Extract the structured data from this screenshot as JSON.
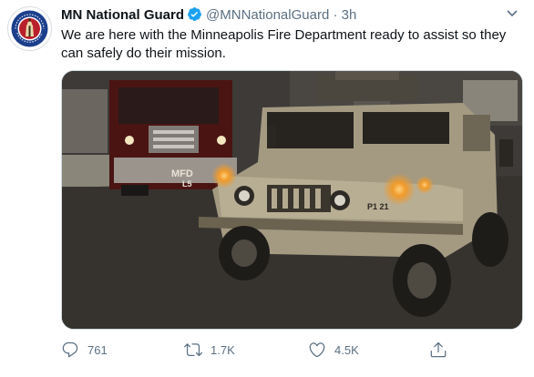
{
  "tweet": {
    "display_name": "MN National Guard",
    "handle": "@MNNationalGuard",
    "separator": "·",
    "time": "3h",
    "text": "We are here with the Minneapolis Fire Department ready to assist so they can safely do their mission.",
    "avatar_icon": "minnesota-national-guard-seal-icon",
    "avatar_text": "MINNESOTA NATIONAL GUARD · ALWAYS READY",
    "more_icon": "more-options-icon",
    "verified_color": "#1da1f2",
    "photo": {
      "truck_marking_1": "MFD",
      "truck_marking_2": "L5",
      "vehicle_marking": "P1 21"
    }
  },
  "actions": {
    "reply": {
      "icon": "reply-icon",
      "count": "761"
    },
    "retweet": {
      "icon": "retweet-icon",
      "count": "1.7K"
    },
    "like": {
      "icon": "like-icon",
      "count": "4.5K"
    },
    "share": {
      "icon": "share-icon",
      "count": ""
    }
  },
  "colors": {
    "text_primary": "#0f1419",
    "text_secondary": "#5b7083",
    "accent": "#1da1f2"
  }
}
